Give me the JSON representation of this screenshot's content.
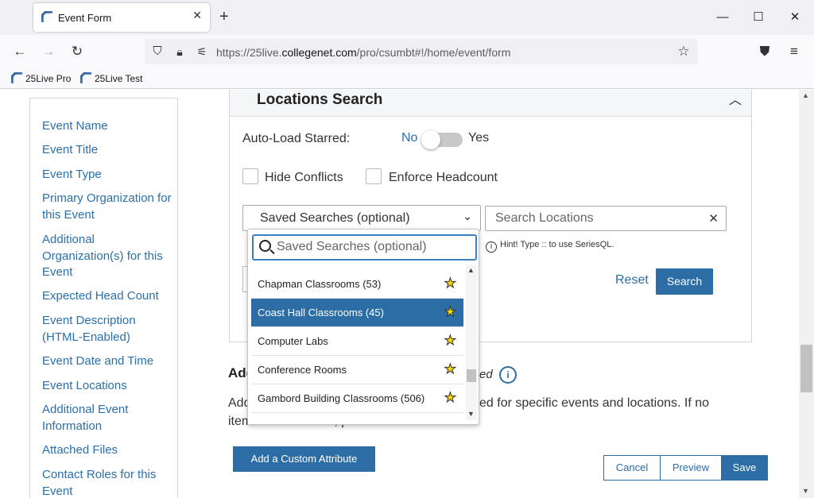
{
  "browser": {
    "tab_title": "Event Form",
    "url_prefix": "https://25live.",
    "url_domain": "collegenet.com",
    "url_path": "/pro/csumbt#!/home/event/form",
    "bookmarks": [
      "25Live Pro",
      "25Live Test"
    ]
  },
  "sidebar": {
    "items": [
      "Event Name",
      "Event Title",
      "Event Type",
      "Primary Organization for this Event",
      "Additional Organization(s) for this Event",
      "Expected Head Count",
      "Event Description (HTML-Enabled)",
      "Event Date and Time",
      "Event Locations",
      "Additional Event Information",
      "Attached Files",
      "Contact Roles for this Event"
    ]
  },
  "locations": {
    "title": "Locations Search",
    "auto_load_label": "Auto-Load Starred:",
    "toggle_no": "No",
    "toggle_yes": "Yes",
    "hide_conflicts": "Hide Conflicts",
    "enforce_headcount": "Enforce Headcount",
    "saved_searches": "Saved Searches (optional)",
    "search_placeholder": "Search Locations",
    "hint": "Hint! Type :: to use SeriesQL.",
    "reset": "Reset",
    "search_button": "Search"
  },
  "dropdown": {
    "placeholder": "Saved Searches (optional)",
    "items": [
      {
        "label": "Chapman Classrooms (53)",
        "selected": false
      },
      {
        "label": "Coast Hall Classrooms (45)",
        "selected": true
      },
      {
        "label": "Computer Labs",
        "selected": false
      },
      {
        "label": "Conference Rooms",
        "selected": false
      },
      {
        "label": "Gambord Building Classrooms (506)",
        "selected": false
      }
    ]
  },
  "attributes": {
    "heading_start": "Add",
    "heading_end": "ed",
    "desc_line1_start": "Add",
    "desc_line1_end": "ed for specific events and locations. If no",
    "desc_line2": "items are available, please continue.",
    "add_button": "Add a Custom Attribute"
  },
  "actions": {
    "cancel": "Cancel",
    "preview": "Preview",
    "save": "Save"
  },
  "colors": {
    "accent": "#2d6da5",
    "link": "#2a6fab"
  }
}
